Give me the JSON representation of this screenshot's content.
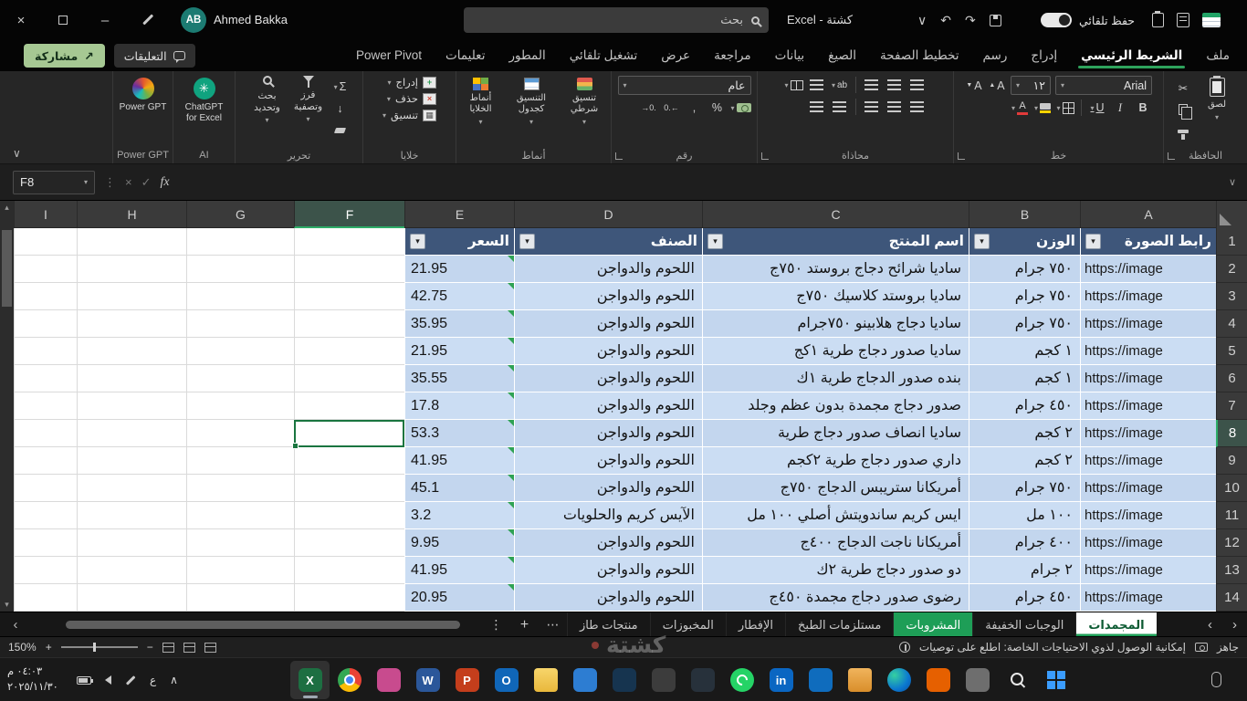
{
  "titlebar": {
    "user": {
      "initials": "AB",
      "name": "Ahmed Bakka"
    },
    "search_placeholder": "بحث",
    "doc_title": "كشتة - Excel",
    "autosave_label": "حفظ تلقائي"
  },
  "ribbon": {
    "tabs": [
      {
        "label": "ملف"
      },
      {
        "label": "الشريط الرئيسي",
        "active": true
      },
      {
        "label": "إدراج"
      },
      {
        "label": "رسم"
      },
      {
        "label": "تخطيط الصفحة"
      },
      {
        "label": "الصيغ"
      },
      {
        "label": "بيانات"
      },
      {
        "label": "مراجعة"
      },
      {
        "label": "عرض"
      },
      {
        "label": "تشغيل تلقائي"
      },
      {
        "label": "المطور"
      },
      {
        "label": "تعليمات"
      },
      {
        "label": "Power Pivot"
      }
    ],
    "comments_label": "التعليقات",
    "share_label": "مشاركة",
    "groups": {
      "clipboard": {
        "label": "الحافظة",
        "paste_label": "لصق"
      },
      "font": {
        "label": "خط",
        "font_name": "Arial",
        "font_size": "١٢"
      },
      "alignment": {
        "label": "محاذاة"
      },
      "number": {
        "label": "رقم",
        "format": "عام"
      },
      "styles": {
        "label": "أنماط",
        "conditional": "تنسيق شرطي",
        "as_table": "التنسيق كجدول",
        "cell_styles": "أنماط الخلايا"
      },
      "cells": {
        "label": "خلايا",
        "insert": "إدراج",
        "del": "حذف",
        "format": "تنسيق"
      },
      "editing": {
        "label": "تحرير",
        "sort_filter": "فرز وتصفية",
        "find_select": "بحث وتحديد"
      },
      "ai": {
        "label": "AI",
        "button": "ChatGPT for Excel"
      },
      "power_gpt": {
        "label": "Power GPT",
        "button": "Power GPT"
      }
    }
  },
  "formula_bar": {
    "name_box": "F8",
    "fx": "fx",
    "formula": ""
  },
  "grid": {
    "columns": [
      "I",
      "H",
      "G",
      "F",
      "E",
      "D",
      "C",
      "B",
      "A"
    ],
    "selected_cell": "F8",
    "selected_column": "F",
    "selected_row": 8,
    "header_row": {
      "A": "رابط الصورة",
      "B": "الوزن",
      "C": "اسم المنتج",
      "D": "الصنف",
      "E": "السعر"
    },
    "rows": [
      {
        "n": 2,
        "A": "https://image",
        "B": "٧٥٠ جرام",
        "C": "ساديا شرائح دجاج بروستد ٧٥٠ج",
        "D": "اللحوم والدواجن",
        "E": "21.95"
      },
      {
        "n": 3,
        "A": "https://image",
        "B": "٧٥٠ جرام",
        "C": "ساديا بروستد كلاسيك ٧٥٠ج",
        "D": "اللحوم والدواجن",
        "E": "42.75"
      },
      {
        "n": 4,
        "A": "https://image",
        "B": "٧٥٠ جرام",
        "C": "ساديا دجاج هلابينو ٧٥٠جرام",
        "D": "اللحوم والدواجن",
        "E": "35.95"
      },
      {
        "n": 5,
        "A": "https://image",
        "B": "١ كجم",
        "C": "ساديا صدور دجاج طرية ١كج",
        "D": "اللحوم والدواجن",
        "E": "21.95"
      },
      {
        "n": 6,
        "A": "https://image",
        "B": "١ كجم",
        "C": "بنده صدور الدجاج طرية ١ك",
        "D": "اللحوم والدواجن",
        "E": "35.55"
      },
      {
        "n": 7,
        "A": "https://image",
        "B": "٤٥٠ جرام",
        "C": "صدور دجاج مجمدة بدون عظم وجلد",
        "D": "اللحوم والدواجن",
        "E": "17.8"
      },
      {
        "n": 8,
        "A": "https://image",
        "B": "٢ كجم",
        "C": "ساديا انصاف صدور دجاج طرية",
        "D": "اللحوم والدواجن",
        "E": "53.3"
      },
      {
        "n": 9,
        "A": "https://image",
        "B": "٢ كجم",
        "C": "داري صدور دجاج طرية ٢كجم",
        "D": "اللحوم والدواجن",
        "E": "41.95"
      },
      {
        "n": 10,
        "A": "https://image",
        "B": "٧٥٠ جرام",
        "C": "أمريكانا ستريبس الدجاج ٧٥٠ج",
        "D": "اللحوم والدواجن",
        "E": "45.1"
      },
      {
        "n": 11,
        "A": "https://image",
        "B": "١٠٠ مل",
        "C": "ايس كريم ساندويتش أصلي ١٠٠ مل",
        "D": "الآيس كريم والحلويات",
        "E": "3.2"
      },
      {
        "n": 12,
        "A": "https://image",
        "B": "٤٠٠ جرام",
        "C": "أمريكانا ناجت الدجاج ٤٠٠ج",
        "D": "اللحوم والدواجن",
        "E": "9.95"
      },
      {
        "n": 13,
        "A": "https://image",
        "B": "٢ جرام",
        "C": "دو صدور دجاج طرية ٢ك",
        "D": "اللحوم والدواجن",
        "E": "41.95"
      },
      {
        "n": 14,
        "A": "https://image",
        "B": "٤٥٠ جرام",
        "C": "رضوى صدور دجاج مجمدة ٤٥٠ج",
        "D": "اللحوم والدواجن",
        "E": "20.95"
      }
    ]
  },
  "sheet_bar": {
    "tabs": [
      {
        "label": "المجمدات",
        "state": "active"
      },
      {
        "label": "الوجبات الخفيفة",
        "state": "normal"
      },
      {
        "label": "المشروبات",
        "state": "green"
      },
      {
        "label": "مستلزمات الطبخ",
        "state": "normal"
      },
      {
        "label": "الإفطار",
        "state": "normal"
      },
      {
        "label": "المخبوزات",
        "state": "normal"
      },
      {
        "label": "منتجات طاز",
        "state": "normal"
      }
    ]
  },
  "status_bar": {
    "zoom": "150%",
    "ready": "جاهز",
    "accessibility": "إمكانية الوصول لذوي الاحتياجات الخاصة: اطلع على توصيات"
  },
  "taskbar": {
    "time": "٠٤:٠٣ م",
    "date": "٢٠٢٥/١١/٣٠",
    "language": "ع",
    "apps": [
      {
        "name": "excel",
        "color": "#1D6F42",
        "glyph": "X",
        "active": true
      },
      {
        "name": "chrome",
        "color": "#EA4335",
        "glyph": ""
      },
      {
        "name": "design-app",
        "color": "#C84B8E",
        "glyph": ""
      },
      {
        "name": "word",
        "color": "#2B579A",
        "glyph": "W"
      },
      {
        "name": "powerpoint",
        "color": "#C43E1C",
        "glyph": "P"
      },
      {
        "name": "outlook",
        "color": "#1066B8",
        "glyph": "O"
      },
      {
        "name": "files",
        "color": "#F2C84B",
        "glyph": ""
      },
      {
        "name": "weather",
        "color": "#2D7DD2",
        "glyph": ""
      },
      {
        "name": "compass-app",
        "color": "#16344F",
        "glyph": ""
      },
      {
        "name": "dark-app",
        "color": "#3C3C3C",
        "glyph": ""
      },
      {
        "name": "phone-link",
        "color": "#27313B",
        "glyph": ""
      },
      {
        "name": "whatsapp",
        "color": "#25D366",
        "glyph": ""
      },
      {
        "name": "blue-social-app",
        "color": "#0A66C2",
        "glyph": "in"
      },
      {
        "name": "store",
        "color": "#0F6CBD",
        "glyph": ""
      },
      {
        "name": "folder",
        "color": "#E8A33D",
        "glyph": ""
      },
      {
        "name": "edge",
        "color": "#2AA7D4",
        "glyph": ""
      },
      {
        "name": "firefox",
        "color": "#E66000",
        "glyph": ""
      },
      {
        "name": "utility-app",
        "color": "#6E6E6E",
        "glyph": ""
      },
      {
        "name": "search",
        "color": "#2E2E2E",
        "glyph": ""
      },
      {
        "name": "start",
        "color": "#2E2E2E",
        "glyph": ""
      }
    ]
  },
  "watermark": "كشتة"
}
